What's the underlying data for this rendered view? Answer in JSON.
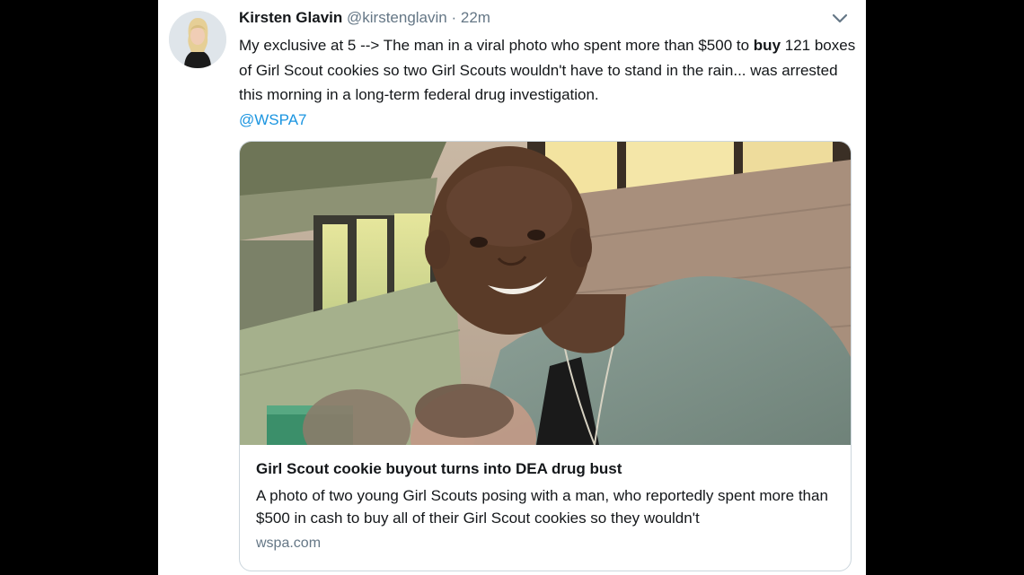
{
  "tweet": {
    "author_name": "Kirsten Glavin",
    "author_handle": "@kirstenglavin",
    "separator": "·",
    "time_ago": "22m",
    "text_part1": "My exclusive at 5 --> The man in a viral photo who spent more than $500 to ",
    "text_bold": "buy",
    "text_part2": " 121 boxes of Girl Scout cookies so two Girl Scouts wouldn't have to stand in the rain... was arrested this morning in a long-term federal drug investigation.",
    "mention": "@WSPA7"
  },
  "card": {
    "title": "Girl Scout cookie buyout turns into DEA drug bust",
    "description": "A photo of two young Girl Scouts posing with a man, who reportedly spent more than $500 in cash to buy all of their Girl Scout cookies so they wouldn't",
    "domain": "wspa.com"
  },
  "icons": {
    "caret": "chevron-down-icon"
  },
  "colors": {
    "link": "#1b95e0",
    "secondary_text": "#657786",
    "primary_text": "#14171a",
    "border": "#ccd6dd"
  }
}
